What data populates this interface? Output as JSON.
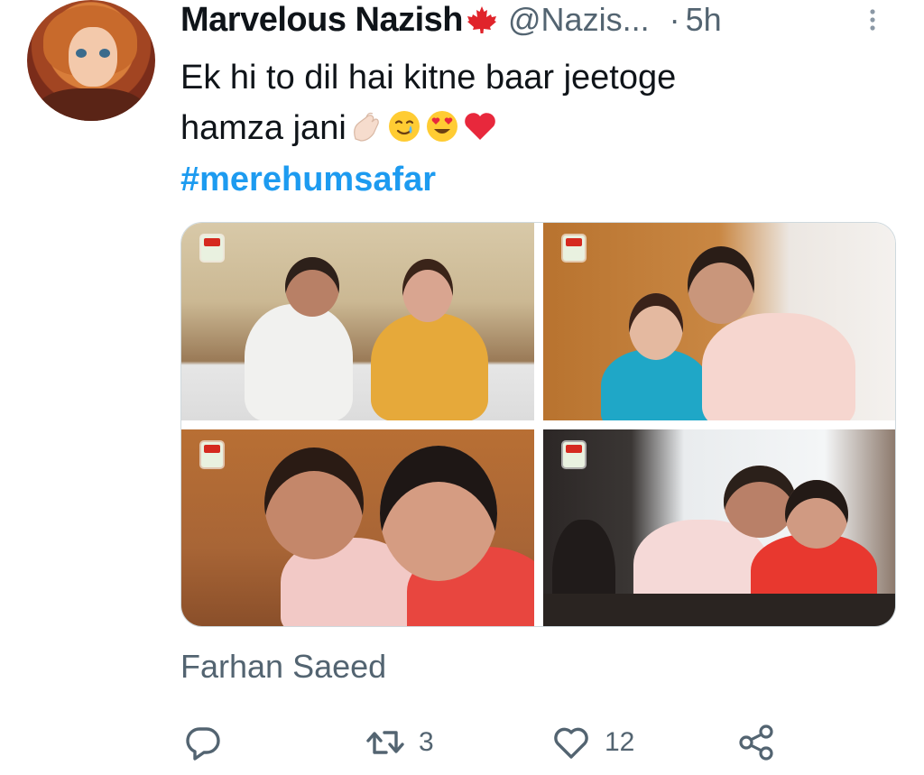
{
  "tweet": {
    "display_name": "Marvelous Nazish",
    "handle": "@Nazis...",
    "separator": "·",
    "timestamp": "5h",
    "text_line1": "Ek hi to dil hai kitne baar jeetoge",
    "text_line2": "hamza jani",
    "emojis": [
      "pinching-hand-emoji",
      "smiling-face-with-tear-emoji",
      "heart-eyes-emoji",
      "red-heart-emoji"
    ],
    "hashtag": "#merehumsafar",
    "media_caption": "Farhan Saeed",
    "media_count": 4
  },
  "actions": {
    "reply_count": "",
    "retweet_count": "3",
    "like_count": "12"
  },
  "icons": {
    "flag": "canada-flag-icon",
    "more": "more-icon",
    "reply": "reply-icon",
    "retweet": "retweet-icon",
    "like": "heart-icon",
    "share": "share-icon"
  },
  "colors": {
    "text": "#0f1419",
    "secondary": "#536471",
    "hashtag": "#1d9bf0",
    "flag_red": "#e0242b"
  }
}
